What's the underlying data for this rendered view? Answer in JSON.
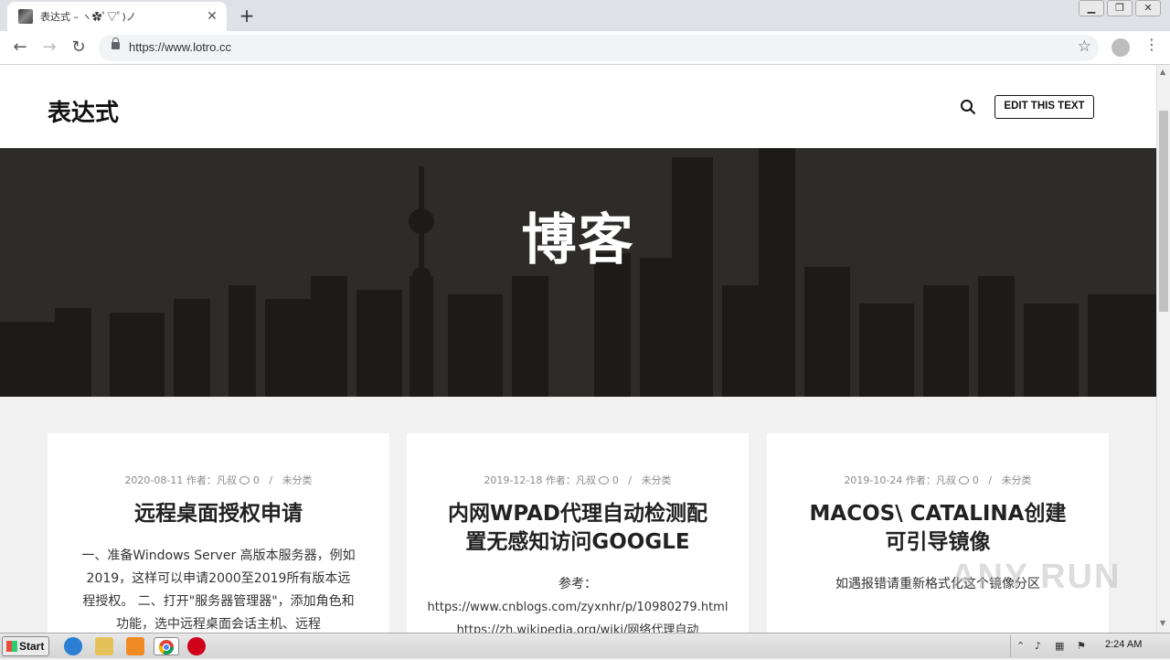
{
  "browser": {
    "tab_title": "表达式 – ヽ✿ﾟ▽ﾟ)ノ",
    "url": "https://www.lotro.cc"
  },
  "site": {
    "title": "表达式",
    "edit_button": "EDIT THIS TEXT",
    "hero_title": "博客"
  },
  "posts": [
    {
      "date": "2020-08-11",
      "author_label": "作者：凡叔",
      "comments": "0",
      "category": "未分类",
      "title": "远程桌面授权申请",
      "excerpt": "一、准备Windows Server 高版本服务器，例如2019，这样可以申请2000至2019所有版本远程授权。 二、打开\"服务器管理器\"，添加角色和功能，选中远程桌面会话主机、远程"
    },
    {
      "date": "2019-12-18",
      "author_label": "作者：凡叔",
      "comments": "0",
      "category": "未分类",
      "title": "内网WPAD代理自动检测配置无感知访问GOOGLE",
      "excerpt_label": "参考：",
      "excerpt_link1": "https://www.cnblogs.com/zyxnhr/p/10980279.html",
      "excerpt_link2": "https://zh.wikipedia.org/wiki/网络代理自动"
    },
    {
      "date": "2019-10-24",
      "author_label": "作者：凡叔",
      "comments": "0",
      "category": "未分类",
      "title": "MACOS\\ CATALINA创建可引导镜像",
      "excerpt": "如遇报错请重新格式化这个镜像分区"
    }
  ],
  "watermark": "ANY RUN",
  "taskbar": {
    "start_label": "Start",
    "clock": "2:24 AM"
  }
}
